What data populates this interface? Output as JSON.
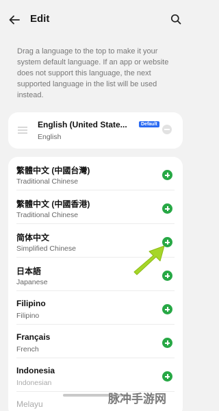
{
  "header": {
    "title": "Edit",
    "back_icon": "arrow-left-icon",
    "search_icon": "search-icon"
  },
  "hint": "Drag a language to the top to make it your system default language. If an app or website does not support this language, the next supported language in the list will be used instead.",
  "default_language": {
    "name": "English (United State...",
    "badge": "Default",
    "subtitle": "English",
    "drag_icon": "drag-handle-icon",
    "remove_icon": "minus-circle-icon"
  },
  "languages": [
    {
      "name": "繁體中文 (中國台灣)",
      "subtitle": "Traditional Chinese"
    },
    {
      "name": "繁體中文 (中國香港)",
      "subtitle": "Traditional Chinese"
    },
    {
      "name": "简体中文",
      "subtitle": "Simplified Chinese"
    },
    {
      "name": "日本語",
      "subtitle": "Japanese"
    },
    {
      "name": "Filipino",
      "subtitle": "Filipino"
    },
    {
      "name": "Français",
      "subtitle": "French"
    },
    {
      "name": "Indonesia",
      "subtitle": "Indonesian"
    },
    {
      "name": "Melayu",
      "subtitle": ""
    }
  ],
  "colors": {
    "accent_green": "#27a845",
    "badge_blue": "#2a6af2",
    "arrow_green": "#a6d629"
  },
  "watermark": "脉冲手游网"
}
